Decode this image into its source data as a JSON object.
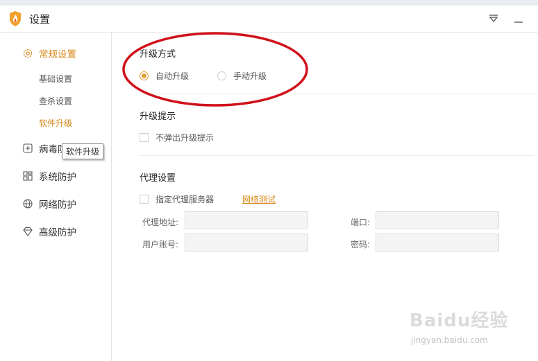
{
  "window": {
    "title": "设置",
    "controls": [
      "menu-icon",
      "minimize-icon"
    ]
  },
  "sidebar": {
    "items": [
      {
        "label": "常规设置",
        "icon": "gear-icon",
        "active": true
      },
      {
        "label": "病毒防",
        "icon": "plus-square-icon",
        "active": false
      },
      {
        "label": "系统防护",
        "icon": "grid-icon",
        "active": false
      },
      {
        "label": "网络防护",
        "icon": "globe-icon",
        "active": false
      },
      {
        "label": "高级防护",
        "icon": "diamond-icon",
        "active": false
      }
    ],
    "subitems": [
      {
        "label": "基础设置",
        "active": false
      },
      {
        "label": "查杀设置",
        "active": false
      },
      {
        "label": "软件升级",
        "active": true
      }
    ],
    "tooltip": "软件升级"
  },
  "upgrade_mode": {
    "title": "升级方式",
    "auto_label": "自动升级",
    "manual_label": "手动升级",
    "selected": "auto"
  },
  "upgrade_notice": {
    "title": "升级提示",
    "no_popup_label": "不弹出升级提示",
    "checked": false
  },
  "proxy": {
    "title": "代理设置",
    "use_proxy_label": "指定代理服务器",
    "checked": false,
    "network_test_label": "网络测试",
    "address_label": "代理地址:",
    "port_label": "端口:",
    "user_label": "用户账号:",
    "password_label": "密码:",
    "address_value": "",
    "port_value": "",
    "user_value": "",
    "password_value": ""
  },
  "watermark": {
    "text": "Baidu经验",
    "sub": "jingyan.baidu.com"
  },
  "colors": {
    "accent": "#d68a1a",
    "annotation": "#d0101a"
  }
}
